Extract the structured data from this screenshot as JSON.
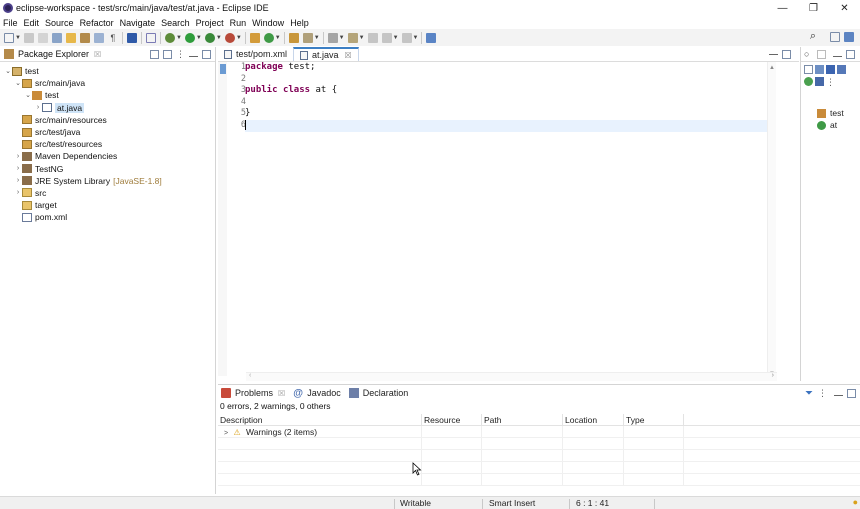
{
  "window": {
    "title": "eclipse-workspace - test/src/main/java/test/at.java - Eclipse IDE",
    "buttons": {
      "minimize": "—",
      "restore": "❐",
      "close": "✕"
    }
  },
  "menubar": {
    "items": [
      "File",
      "Edit",
      "Source",
      "Refactor",
      "Navigate",
      "Search",
      "Project",
      "Run",
      "Window",
      "Help"
    ]
  },
  "package_explorer": {
    "title": "Package Explorer",
    "close_glyph": "☒",
    "tree": [
      {
        "label": "test",
        "indent": 0,
        "twisty": "v",
        "icon": "project-icon"
      },
      {
        "label": "src/main/java",
        "indent": 1,
        "twisty": "v",
        "icon": "source-folder-icon"
      },
      {
        "label": "test",
        "indent": 2,
        "twisty": "v",
        "icon": "package-icon"
      },
      {
        "label": "at.java",
        "indent": 3,
        "twisty": ">",
        "icon": "java-file-icon",
        "selected": true
      },
      {
        "label": "src/main/resources",
        "indent": 1,
        "twisty": "",
        "icon": "source-folder-icon"
      },
      {
        "label": "src/test/java",
        "indent": 1,
        "twisty": "",
        "icon": "source-folder-icon"
      },
      {
        "label": "src/test/resources",
        "indent": 1,
        "twisty": "",
        "icon": "source-folder-icon"
      },
      {
        "label": "Maven Dependencies",
        "indent": 1,
        "twisty": ">",
        "icon": "library-icon"
      },
      {
        "label": "TestNG",
        "indent": 1,
        "twisty": ">",
        "icon": "library-icon"
      },
      {
        "label": "JRE System Library",
        "deco": "[JavaSE-1.8]",
        "indent": 1,
        "twisty": ">",
        "icon": "library-icon"
      },
      {
        "label": "src",
        "indent": 1,
        "twisty": ">",
        "icon": "folder-icon"
      },
      {
        "label": "target",
        "indent": 1,
        "twisty": "",
        "icon": "folder-icon"
      },
      {
        "label": "pom.xml",
        "indent": 1,
        "twisty": "",
        "icon": "xml-file-icon"
      }
    ]
  },
  "editor": {
    "tabs": [
      {
        "label": "test/pom.xml",
        "active": false
      },
      {
        "label": "at.java",
        "active": true
      }
    ],
    "close_glyph": "☒",
    "lines": [
      {
        "n": "1",
        "text": "package test;"
      },
      {
        "n": "2",
        "text": ""
      },
      {
        "n": "3",
        "text": "public class at {"
      },
      {
        "n": "4",
        "text": ""
      },
      {
        "n": "5",
        "text": "}"
      },
      {
        "n": "6",
        "text": ""
      }
    ]
  },
  "outline": {
    "items": [
      {
        "label": "test",
        "icon": "package-icon"
      },
      {
        "label": "at",
        "icon": "class-icon"
      }
    ]
  },
  "problems": {
    "tabs": [
      {
        "label": "Problems",
        "icon": "problems-icon",
        "closable": true
      },
      {
        "label": "Javadoc",
        "icon": "javadoc-icon",
        "closable": false
      },
      {
        "label": "Declaration",
        "icon": "declaration-icon",
        "closable": false
      }
    ],
    "summary": "0 errors, 2 warnings, 0 others",
    "columns": [
      "Description",
      "Resource",
      "Path",
      "Location",
      "Type"
    ],
    "rows": [
      {
        "description": "Warnings (2 items)",
        "resource": "",
        "path": "",
        "location": "",
        "type": ""
      }
    ]
  },
  "statusbar": {
    "writable": "Writable",
    "insert_mode": "Smart Insert",
    "position": "6 : 1 : 41"
  },
  "colors": {
    "keyword": "#7f0055",
    "accent": "#3c7fc4",
    "current_line": "#e8f2fe"
  }
}
